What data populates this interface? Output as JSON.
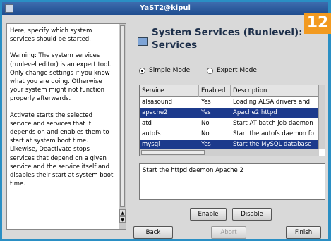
{
  "window": {
    "title": "YaST2@kipul"
  },
  "badge": "12",
  "help": {
    "paragraphs": [
      "Here, specify which system services should be started.",
      "Warning: The system services (runlevel editor) is an expert tool. Only change settings if you know what you are doing. Otherwise your system might not function properly afterwards.",
      "Activate starts the selected service and services that it depends on and enables them to start at system boot time. Likewise, Deactivate stops services that depend on a given service and the service itself and disables their start at system boot time."
    ]
  },
  "main": {
    "heading": "System Services (Runlevel): Services",
    "modes": {
      "simple": "Simple Mode",
      "expert": "Expert Mode",
      "selected": "simple"
    },
    "table": {
      "columns": [
        "Service",
        "Enabled",
        "Description"
      ],
      "rows": [
        {
          "service": "alsasound",
          "enabled": "Yes",
          "description": "Loading ALSA drivers and",
          "selected": false
        },
        {
          "service": "apache2",
          "enabled": "Yes",
          "description": "Apache2 httpd",
          "selected": true
        },
        {
          "service": "atd",
          "enabled": "No",
          "description": "Start AT batch job daemon",
          "selected": false
        },
        {
          "service": "autofs",
          "enabled": "No",
          "description": "Start the autofs daemon fo",
          "selected": false
        },
        {
          "service": "mysql",
          "enabled": "Yes",
          "description": "Start the MySQL database",
          "selected": true
        }
      ]
    },
    "description_text": "Start the httpd daemon Apache 2",
    "enable_label": "Enable",
    "disable_label": "Disable"
  },
  "footer": {
    "back": "Back",
    "abort": "Abort",
    "finish": "Finish"
  }
}
